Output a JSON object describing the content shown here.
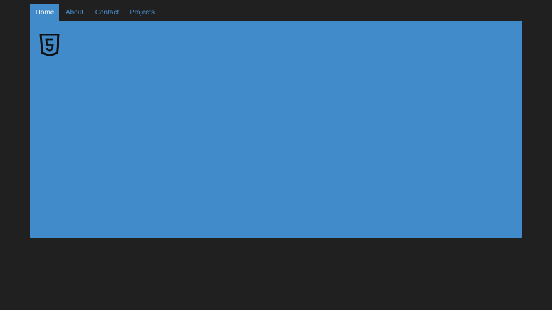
{
  "nav": {
    "tabs": [
      {
        "label": "Home",
        "active": true
      },
      {
        "label": "About",
        "active": false
      },
      {
        "label": "Contact",
        "active": false
      },
      {
        "label": "Projects",
        "active": false
      }
    ]
  },
  "content": {
    "icon": "html5-icon"
  },
  "colors": {
    "background": "#202020",
    "accent": "#428bca",
    "link": "#4a8fd0",
    "active_text": "#ffffff"
  }
}
